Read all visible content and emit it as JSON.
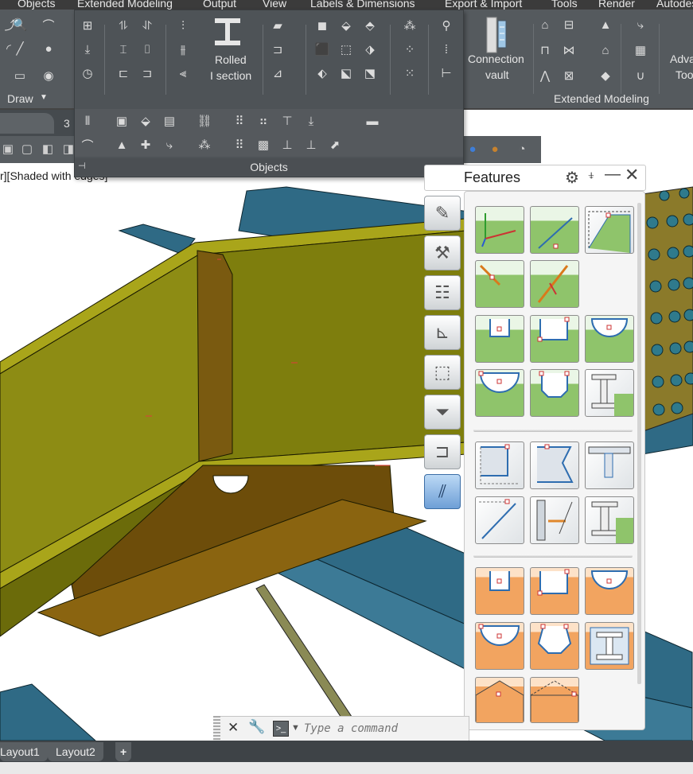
{
  "menu": [
    "Objects",
    "Extended Modeling",
    "Output",
    "View",
    "Labels & Dimensions",
    "Export & Import",
    "Tools",
    "Render",
    "Autodesk"
  ],
  "ribbon": {
    "draw_panel_label": "Draw",
    "extended_modeling_label": "Extended Modeling",
    "rolled_section_line1": "Rolled",
    "rolled_section_line2": "I section",
    "connection_vault_line1": "Connection",
    "connection_vault_line2": "vault",
    "advance_tools_line1": "Adva",
    "advance_tools_line2": "Too"
  },
  "objects_panel": {
    "title": "Objects"
  },
  "doc_tab": {
    "label": "3"
  },
  "viewport": {
    "label": "r][Shaded with edges]"
  },
  "features": {
    "title": "Features",
    "categories": [
      "Pencil",
      "Tools",
      "User properties",
      "Coordinate axes",
      "Blank",
      "Filter",
      "Profile cut",
      "Plate features"
    ],
    "active_category": "Plate features"
  },
  "command": {
    "placeholder": "Type a command"
  },
  "layouts": {
    "tab1": "Layout1",
    "tab2": "Layout2",
    "add": "+"
  },
  "colors": {
    "ribbon": "#555a5e",
    "steel_olive": "#7e7e0d",
    "steel_blue": "#2f6a85",
    "feature_green": "#8fc46b",
    "feature_orange": "#f2a460"
  }
}
